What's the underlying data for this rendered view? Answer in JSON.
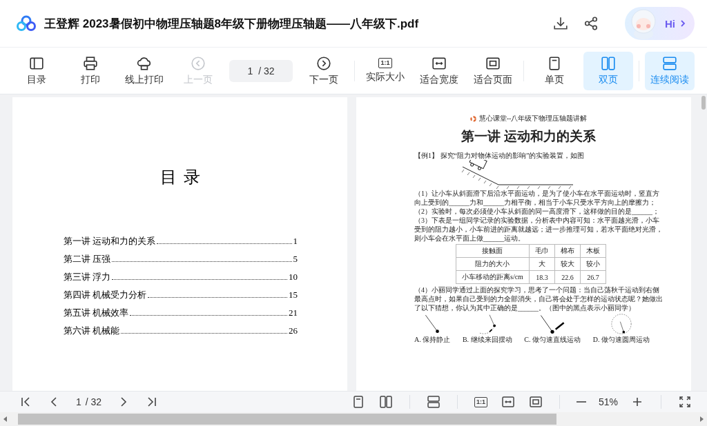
{
  "header": {
    "title": "王登辉 2023暑假初中物理压轴题8年级下册物理压轴题——八年级下.pdf",
    "actions": [
      {
        "kind": "download"
      },
      {
        "kind": "share"
      }
    ],
    "assistant": {
      "greeting": "Hi"
    }
  },
  "toolbar": {
    "groups": [
      [
        {
          "kind": "toc",
          "label": "目录",
          "disabled": false,
          "selected": false
        },
        {
          "kind": "print",
          "label": "打印",
          "disabled": false,
          "selected": false
        },
        {
          "kind": "cloud-print",
          "label": "线上打印",
          "disabled": false,
          "selected": false
        },
        {
          "kind": "prev",
          "label": "上一页",
          "disabled": true,
          "selected": false
        },
        {
          "kind": "page",
          "value": "1",
          "total": "/ 32"
        },
        {
          "kind": "next",
          "label": "下一页",
          "disabled": false,
          "selected": false
        }
      ],
      [
        {
          "kind": "actual",
          "glyph": "1:1",
          "label": "实际大小",
          "disabled": false,
          "selected": false
        },
        {
          "kind": "fit-width",
          "label": "适合宽度",
          "disabled": false,
          "selected": false
        },
        {
          "kind": "fit-page",
          "label": "适合页面",
          "disabled": false,
          "selected": false
        }
      ],
      [
        {
          "kind": "single",
          "label": "单页",
          "disabled": false,
          "selected": false
        },
        {
          "kind": "double",
          "label": "双页",
          "disabled": false,
          "selected": true
        }
      ],
      [
        {
          "kind": "continuous",
          "label": "连续阅读",
          "disabled": false,
          "selected": true
        }
      ]
    ]
  },
  "left_page": {
    "heading": "目 录",
    "entries": [
      {
        "title": "第一讲 运动和力的关系",
        "page": "1"
      },
      {
        "title": "第二讲 压强",
        "page": "5"
      },
      {
        "title": "第三讲 浮力",
        "page": "10"
      },
      {
        "title": "第四讲 机械受力分析",
        "page": "15"
      },
      {
        "title": "第五讲 机械效率",
        "page": "21"
      },
      {
        "title": "第六讲 机械能",
        "page": "26"
      }
    ]
  },
  "right_page": {
    "running_header": "慧心课堂--八年级下物理压轴题讲解",
    "title": "第一讲 运动和力的关系",
    "blocks": [
      {
        "kind": "paragraph",
        "text": "【例1】 探究“阻力对物体运动的影响”的实验装置，如图"
      },
      {
        "kind": "incline_figure"
      },
      {
        "kind": "paragraph",
        "text": "（1）让小车从斜面滑下后沿水平面运动，是为了使小车在水平面运动时，竖直方向上受到的______力和______力相平衡，相当于小车只受水平方向上的摩擦力；"
      },
      {
        "kind": "paragraph",
        "text": "（2）实验时，每次必须使小车从斜面的同一高度滑下，这样做的目的是______；"
      },
      {
        "kind": "paragraph",
        "text": "（3）下表是一组同学记录的实验数据，分析表中内容可知：水平面越光滑，小车受到的阻力越小，小车前进的距离就越远；进一步推理可知，若水平面绝对光滑，则小车会在水平面上做______运动。"
      },
      {
        "kind": "table",
        "rows": [
          [
            "接触面",
            "毛巾",
            "棉布",
            "木板"
          ],
          [
            "阻力的大小",
            "大",
            "较大",
            "较小"
          ],
          [
            "小车移动的距离s/cm",
            "18.3",
            "22.6",
            "26.7"
          ]
        ]
      },
      {
        "kind": "paragraph",
        "text": "（4）小丽同学通过上面的探究学习，思考了一个问题：当自己荡秋千运动到右侧最高点时，如果自己受到的力全部消失，自己将会处于怎样的运动状态呢？她做出了以下猜想，你认为其中正确的是______。（图中的黑点表示小丽同学）"
      },
      {
        "kind": "options",
        "items": [
          {
            "kind": "rest",
            "label": "A. 保持静止"
          },
          {
            "kind": "swing",
            "label": "B. 继续来回摆动"
          },
          {
            "kind": "straight",
            "label": "C. 做匀速直线运动"
          },
          {
            "kind": "circle",
            "label": "D. 做匀速圆周运动"
          }
        ]
      }
    ]
  },
  "bottom_bar": {
    "left": [
      {
        "kind": "first"
      },
      {
        "kind": "prev"
      },
      {
        "kind": "page",
        "value": "1",
        "total": "/ 32"
      },
      {
        "kind": "next"
      },
      {
        "kind": "last"
      }
    ],
    "right": [
      [
        {
          "kind": "single"
        },
        {
          "kind": "double"
        }
      ],
      [
        {
          "kind": "continuous"
        }
      ],
      [
        {
          "kind": "actual",
          "glyph": "1:1"
        },
        {
          "kind": "fit-width"
        },
        {
          "kind": "fit-page"
        }
      ],
      [
        {
          "kind": "zoom-out"
        },
        {
          "kind": "zoom",
          "value": "51%"
        },
        {
          "kind": "zoom-in"
        }
      ],
      [
        {
          "kind": "fullscreen"
        }
      ]
    ]
  }
}
